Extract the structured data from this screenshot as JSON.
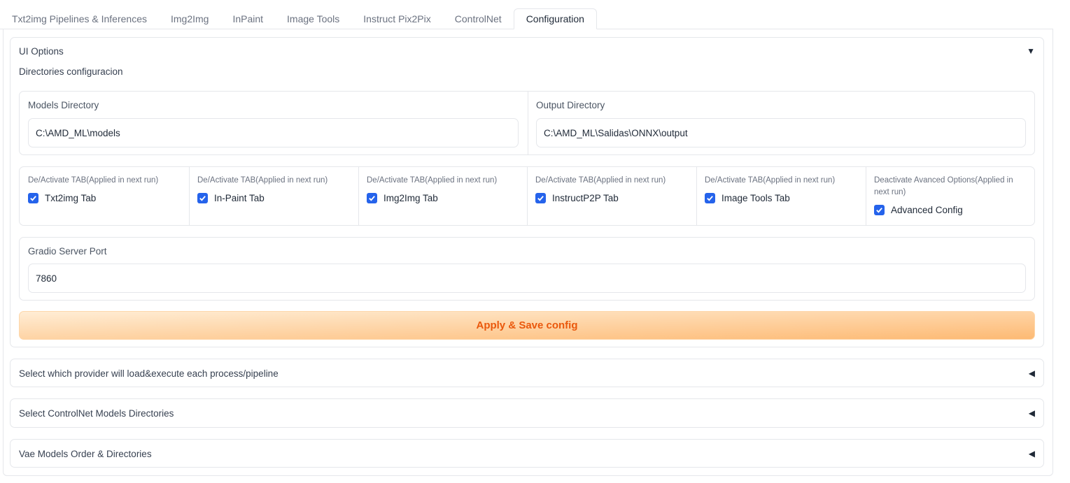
{
  "tabs": [
    {
      "label": "Txt2img Pipelines & Inferences",
      "active": false
    },
    {
      "label": "Img2Img",
      "active": false
    },
    {
      "label": "InPaint",
      "active": false
    },
    {
      "label": "Image Tools",
      "active": false
    },
    {
      "label": "Instruct Pix2Pix",
      "active": false
    },
    {
      "label": "ControlNet",
      "active": false
    },
    {
      "label": "Configuration",
      "active": true
    }
  ],
  "ui_options": {
    "title": "UI Options",
    "arrow": "▼",
    "subtitle": "Directories configuracion",
    "models_dir": {
      "label": "Models Directory",
      "value": "C:\\AMD_ML\\models"
    },
    "output_dir": {
      "label": "Output Directory",
      "value": "C:\\AMD_ML\\Salidas\\ONNX\\output"
    },
    "toggles": [
      {
        "info": "De/Activate TAB(Applied in next run)",
        "label": "Txt2img Tab",
        "checked": true
      },
      {
        "info": "De/Activate TAB(Applied in next run)",
        "label": "In-Paint Tab",
        "checked": true
      },
      {
        "info": "De/Activate TAB(Applied in next run)",
        "label": "Img2Img Tab",
        "checked": true
      },
      {
        "info": "De/Activate TAB(Applied in next run)",
        "label": "InstructP2P Tab",
        "checked": true
      },
      {
        "info": "De/Activate TAB(Applied in next run)",
        "label": "Image Tools Tab",
        "checked": true
      },
      {
        "info": "Deactivate Avanced Options(Applied in next run)",
        "label": "Advanced Config",
        "checked": true
      }
    ],
    "port": {
      "label": "Gradio Server Port",
      "value": "7860"
    },
    "apply_button": "Apply & Save config"
  },
  "collapsed_sections": [
    {
      "title": "Select which provider will load&execute each process/pipeline",
      "arrow": "◀"
    },
    {
      "title": "Select ControlNet Models Directories",
      "arrow": "◀"
    },
    {
      "title": "Vae Models Order & Directories",
      "arrow": "◀"
    }
  ],
  "colors": {
    "accent": "#ea580c",
    "checkbox": "#2563eb",
    "border": "#e5e7eb"
  }
}
